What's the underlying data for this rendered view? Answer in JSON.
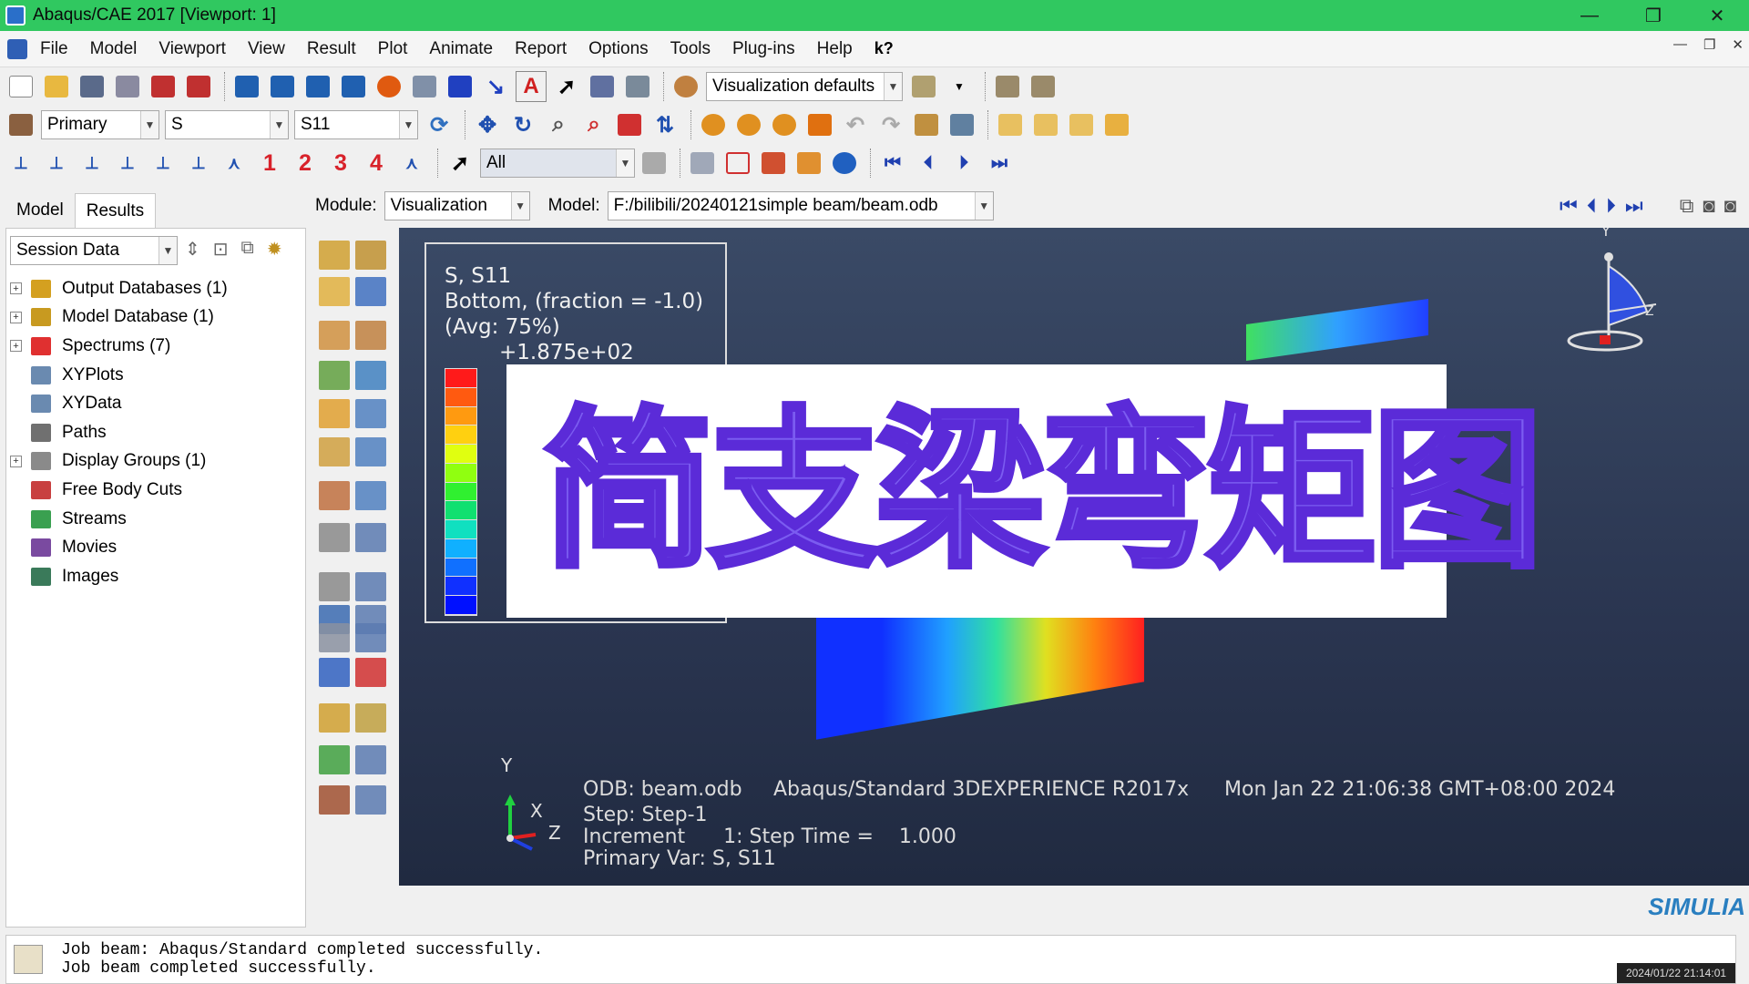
{
  "window": {
    "title": "Abaqus/CAE 2017 [Viewport: 1]",
    "controls": [
      "—",
      "❐",
      "✕"
    ]
  },
  "menu": {
    "items": [
      "File",
      "Model",
      "Viewport",
      "View",
      "Result",
      "Plot",
      "Animate",
      "Report",
      "Options",
      "Tools",
      "Plug-ins",
      "Help"
    ],
    "help_icon": "k?"
  },
  "toolbar": {
    "visualization_defaults": "Visualization defaults",
    "primary": "Primary",
    "variable": "S",
    "component": "S11",
    "selection": "All",
    "numbers": [
      "1",
      "2",
      "3",
      "4"
    ]
  },
  "left_panel": {
    "tabs": [
      "Model",
      "Results"
    ],
    "session_data": "Session Data",
    "tree": [
      {
        "label": "Output Databases (1)",
        "expandable": true,
        "color": "#d4a020"
      },
      {
        "label": "Model Database (1)",
        "expandable": true,
        "color": "#c89a20"
      },
      {
        "label": "Spectrums (7)",
        "expandable": true,
        "color": "#e03030"
      },
      {
        "label": "XYPlots",
        "expandable": false,
        "color": "#6a8ab0"
      },
      {
        "label": "XYData",
        "expandable": false,
        "color": "#6a8ab0"
      },
      {
        "label": "Paths",
        "expandable": false,
        "color": "#707070"
      },
      {
        "label": "Display Groups (1)",
        "expandable": true,
        "color": "#8a8a8a"
      },
      {
        "label": "Free Body Cuts",
        "expandable": false,
        "color": "#c84040"
      },
      {
        "label": "Streams",
        "expandable": false,
        "color": "#3aa050"
      },
      {
        "label": "Movies",
        "expandable": false,
        "color": "#7a4aa0"
      },
      {
        "label": "Images",
        "expandable": false,
        "color": "#3a7a5a"
      }
    ]
  },
  "module_bar": {
    "module_label": "Module:",
    "module_value": "Visualization",
    "model_label": "Model:",
    "model_value": "F:/bilibili/20240121simple beam/beam.odb"
  },
  "viewport": {
    "legend": {
      "line1": "S, S11",
      "line2": "Bottom, (fraction = -1.0)",
      "line3": "(Avg: 75%)",
      "max_value": "+1.875e+02",
      "colors": [
        "#ff1a1a",
        "#ff5a10",
        "#ff9a10",
        "#ffd010",
        "#e0ff10",
        "#90ff10",
        "#30f030",
        "#10e070",
        "#10e0c0",
        "#10b0ff",
        "#1070ff",
        "#1030ff",
        "#0010ff"
      ]
    },
    "banner": "简支梁弯矩图",
    "info": {
      "odb": "ODB: beam.odb",
      "solver": "Abaqus/Standard 3DEXPERIENCE R2017x",
      "date": "Mon Jan 22 21:06:38 GMT+08:00 2024",
      "step": "Step: Step-1",
      "increment": "Increment      1: Step Time =    1.000",
      "primary_var": "Primary Var: S, S11"
    },
    "triad": {
      "y": "Y",
      "x": "X",
      "z": "Z"
    }
  },
  "footer": {
    "brand": "SIMULIA",
    "messages": [
      "Job beam: Abaqus/Standard completed successfully.",
      "Job beam completed successfully."
    ],
    "clock": "2024/01/22 21:14:01"
  }
}
